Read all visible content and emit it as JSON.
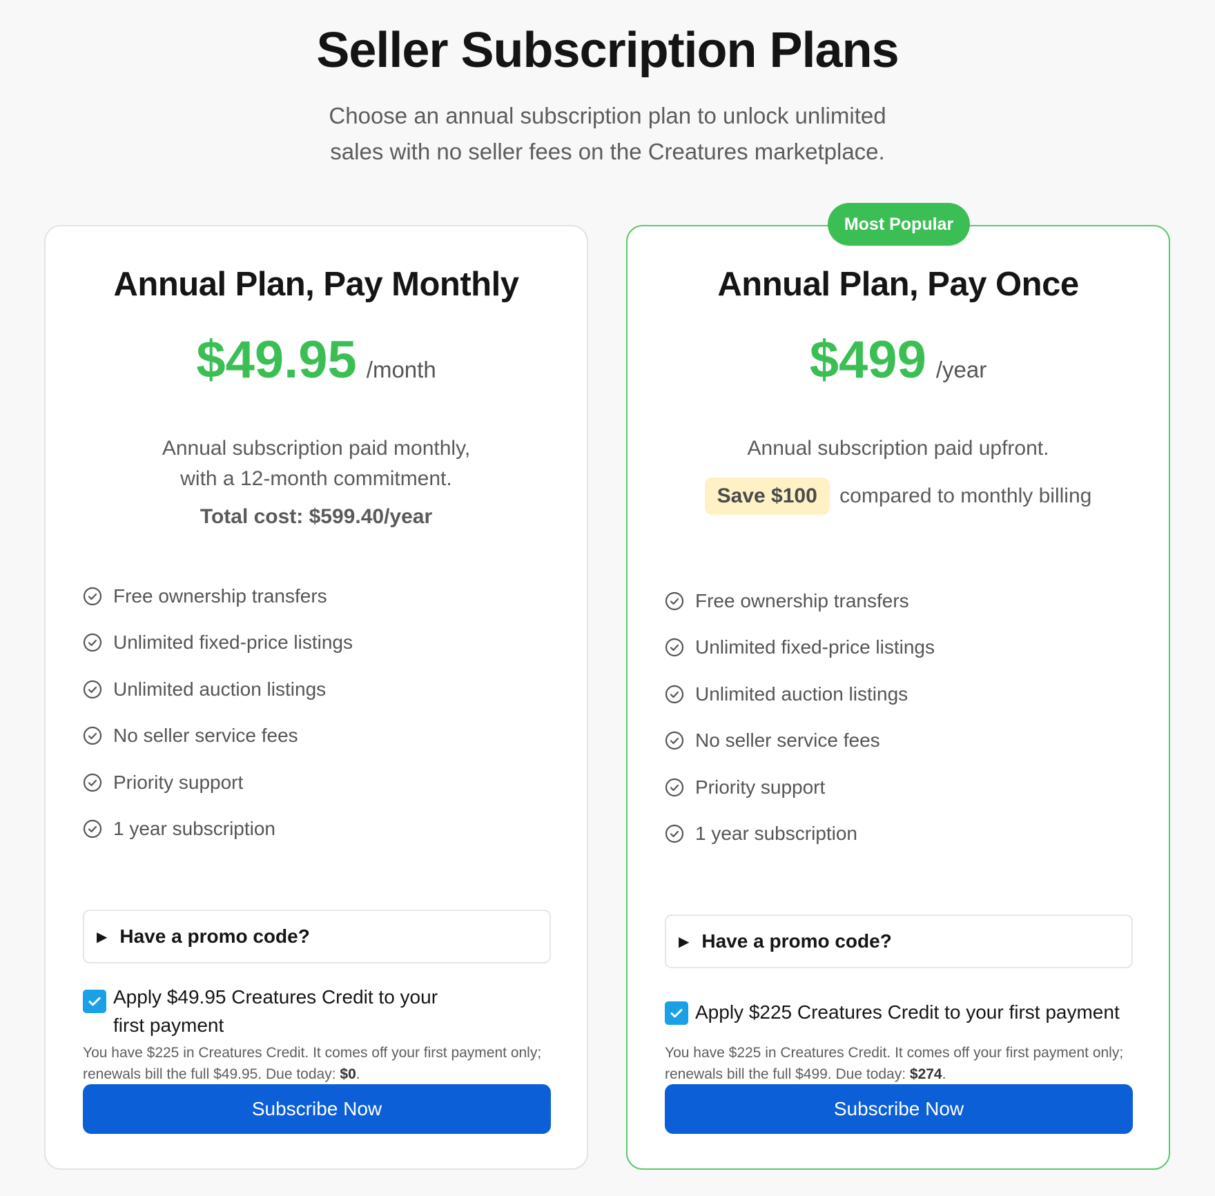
{
  "page": {
    "title": "Seller Subscription Plans",
    "subtitle_line1": "Choose an annual subscription plan to unlock unlimited",
    "subtitle_line2": "sales with no seller fees on the Creatures marketplace."
  },
  "colors": {
    "accent_green": "#3bbf55",
    "primary_blue": "#0c5fd6",
    "checkbox_blue": "#1aa0e6",
    "save_highlight": "#fdf1c5"
  },
  "plans": [
    {
      "title": "Annual Plan, Pay Monthly",
      "price": "$49.95",
      "period": "/month",
      "desc_line1": "Annual subscription paid monthly,",
      "desc_line2": "with a 12-month commitment.",
      "total": "Total cost: $599.40/year",
      "features": [
        "Free ownership transfers",
        "Unlimited fixed-price listings",
        "Unlimited auction listings",
        "No seller service fees",
        "Priority support",
        "1 year subscription"
      ],
      "promo_label": "Have a promo code?",
      "credit_checked": true,
      "credit_label": "Apply $49.95 Creatures Credit to your first payment",
      "note_line1": "You have $225 in Creatures Credit. It comes off your first payment only;",
      "note_line2_prefix": "renewals bill the full $49.95. Due today:",
      "due_today": "$0",
      "button_label": "Subscribe Now"
    },
    {
      "badge": "Most Popular",
      "title": "Annual Plan, Pay Once",
      "price": "$499",
      "period": "/year",
      "desc_line1": "Annual subscription paid upfront.",
      "save_label": "Save $100",
      "save_suffix": "compared to monthly billing",
      "features": [
        "Free ownership transfers",
        "Unlimited fixed-price listings",
        "Unlimited auction listings",
        "No seller service fees",
        "Priority support",
        "1 year subscription"
      ],
      "promo_label": "Have a promo code?",
      "credit_checked": true,
      "credit_label": "Apply $225 Creatures Credit to your first payment",
      "note_line1": "You have $225 in Creatures Credit. It comes off your first payment only;",
      "note_line2_prefix": "renewals bill the full $499. Due today:",
      "due_today": "$274",
      "button_label": "Subscribe Now"
    }
  ],
  "icons": {
    "feature": "check-circle-icon",
    "promo": "triangle-right-icon",
    "checkbox": "checkmark-icon"
  }
}
